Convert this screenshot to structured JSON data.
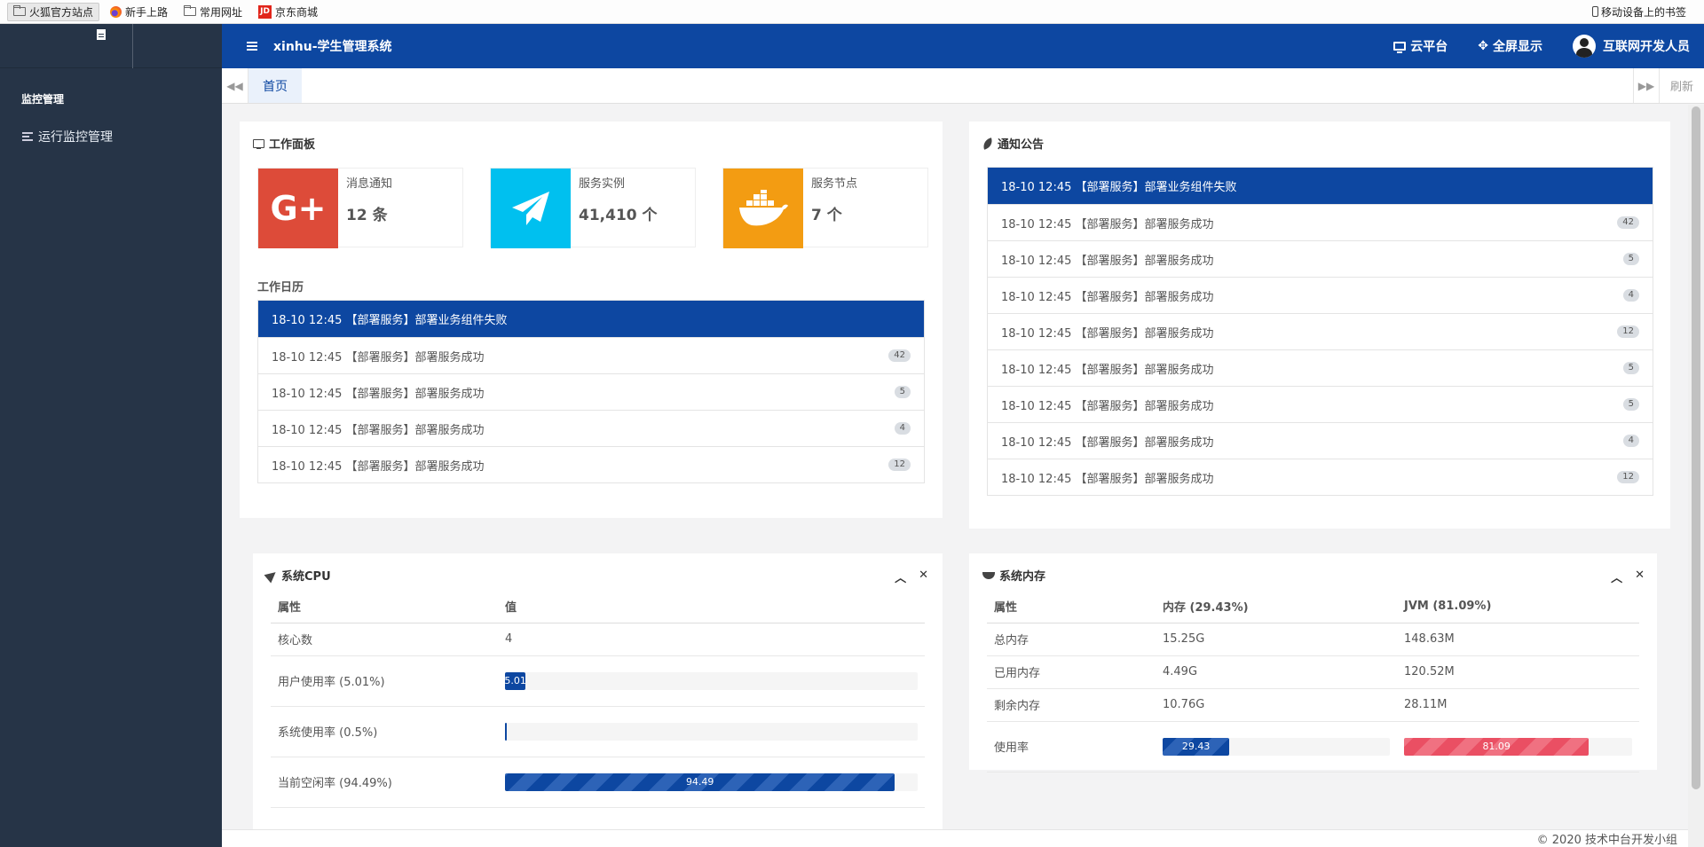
{
  "bookmarks": {
    "items": [
      "火狐官方站点",
      "新手上路",
      "常用网址",
      "京东商城"
    ],
    "jd_logo": "JD",
    "mobile": "移动设备上的书签"
  },
  "sidebar": {
    "section": "监控管理",
    "items": [
      {
        "label": "运行监控管理"
      }
    ]
  },
  "header": {
    "title": "xinhu-学生管理系统",
    "cloud": "云平台",
    "fullscreen": "全屏显示",
    "user": "互联网开发人员"
  },
  "tabs": {
    "home": "首页",
    "refresh": "刷新"
  },
  "workbench": {
    "title": "工作面板",
    "stats": [
      {
        "label": "消息通知",
        "value": "12 条",
        "color": "#dd4b39",
        "icon": "google-plus-icon"
      },
      {
        "label": "服务实例",
        "value": "41,410 个",
        "color": "#00c0ef",
        "icon": "paper-plane-icon"
      },
      {
        "label": "服务节点",
        "value": "7 个",
        "color": "#f39c12",
        "icon": "docker-icon"
      }
    ],
    "calendar_title": "工作日历",
    "calendar": [
      {
        "text": "18-10 12:45 【部署服务】部署业务组件失败",
        "badge": ""
      },
      {
        "text": "18-10 12:45 【部署服务】部署服务成功",
        "badge": "42"
      },
      {
        "text": "18-10 12:45 【部署服务】部署服务成功",
        "badge": "5"
      },
      {
        "text": "18-10 12:45 【部署服务】部署服务成功",
        "badge": "4"
      },
      {
        "text": "18-10 12:45 【部署服务】部署服务成功",
        "badge": "12"
      }
    ]
  },
  "notice": {
    "title": "通知公告",
    "items": [
      {
        "text": "18-10 12:45 【部署服务】部署业务组件失败",
        "badge": ""
      },
      {
        "text": "18-10 12:45 【部署服务】部署服务成功",
        "badge": "42"
      },
      {
        "text": "18-10 12:45 【部署服务】部署服务成功",
        "badge": "5"
      },
      {
        "text": "18-10 12:45 【部署服务】部署服务成功",
        "badge": "4"
      },
      {
        "text": "18-10 12:45 【部署服务】部署服务成功",
        "badge": "12"
      },
      {
        "text": "18-10 12:45 【部署服务】部署服务成功",
        "badge": "5"
      },
      {
        "text": "18-10 12:45 【部署服务】部署服务成功",
        "badge": "5"
      },
      {
        "text": "18-10 12:45 【部署服务】部署服务成功",
        "badge": "4"
      },
      {
        "text": "18-10 12:45 【部署服务】部署服务成功",
        "badge": "12"
      }
    ]
  },
  "cpu": {
    "title": "系统CPU",
    "headers": [
      "属性",
      "值"
    ],
    "core_label": "核心数",
    "core_value": "4",
    "rows": [
      {
        "label": "用户使用率 (5.01%)",
        "percent": 5.01,
        "bar_text": "5.01"
      },
      {
        "label": "系统使用率 (0.5%)",
        "percent": 0.5,
        "bar_text": ""
      },
      {
        "label": "当前空闲率 (94.49%)",
        "percent": 94.49,
        "bar_text": "94.49"
      }
    ]
  },
  "memory": {
    "title": "系统内存",
    "headers": [
      "属性",
      "内存 (29.43%)",
      "JVM (81.09%)"
    ],
    "rows": [
      {
        "label": "总内存",
        "mem": "15.25G",
        "jvm": "148.63M"
      },
      {
        "label": "已用内存",
        "mem": "4.49G",
        "jvm": "120.52M"
      },
      {
        "label": "剩余内存",
        "mem": "10.76G",
        "jvm": "28.11M"
      }
    ],
    "usage_label": "使用率",
    "mem_percent": 29.43,
    "jvm_percent": 81.09,
    "mem_bar_text": "29.43",
    "jvm_bar_text": "81.09"
  },
  "footer": {
    "text": "© 2020 技术中台开发小组"
  }
}
